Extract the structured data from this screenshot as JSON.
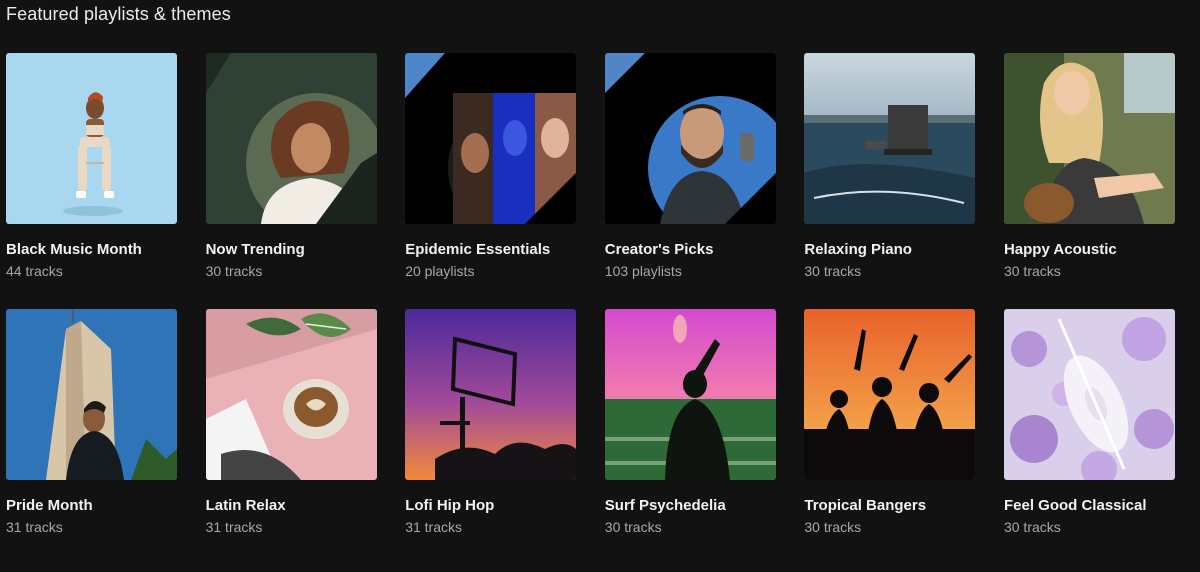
{
  "section": {
    "title": "Featured playlists & themes"
  },
  "playlists": [
    {
      "title": "Black Music Month",
      "subtitle": "44 tracks"
    },
    {
      "title": "Now Trending",
      "subtitle": "30 tracks"
    },
    {
      "title": "Epidemic Essentials",
      "subtitle": "20 playlists"
    },
    {
      "title": "Creator's Picks",
      "subtitle": "103 playlists"
    },
    {
      "title": "Relaxing Piano",
      "subtitle": "30 tracks"
    },
    {
      "title": "Happy Acoustic",
      "subtitle": "30 tracks"
    },
    {
      "title": "Pride Month",
      "subtitle": "31 tracks"
    },
    {
      "title": "Latin Relax",
      "subtitle": "31 tracks"
    },
    {
      "title": "Lofi Hip Hop",
      "subtitle": "31 tracks"
    },
    {
      "title": "Surf Psychedelia",
      "subtitle": "30 tracks"
    },
    {
      "title": "Tropical Bangers",
      "subtitle": "30 tracks"
    },
    {
      "title": "Feel Good Classical",
      "subtitle": "30 tracks"
    }
  ]
}
